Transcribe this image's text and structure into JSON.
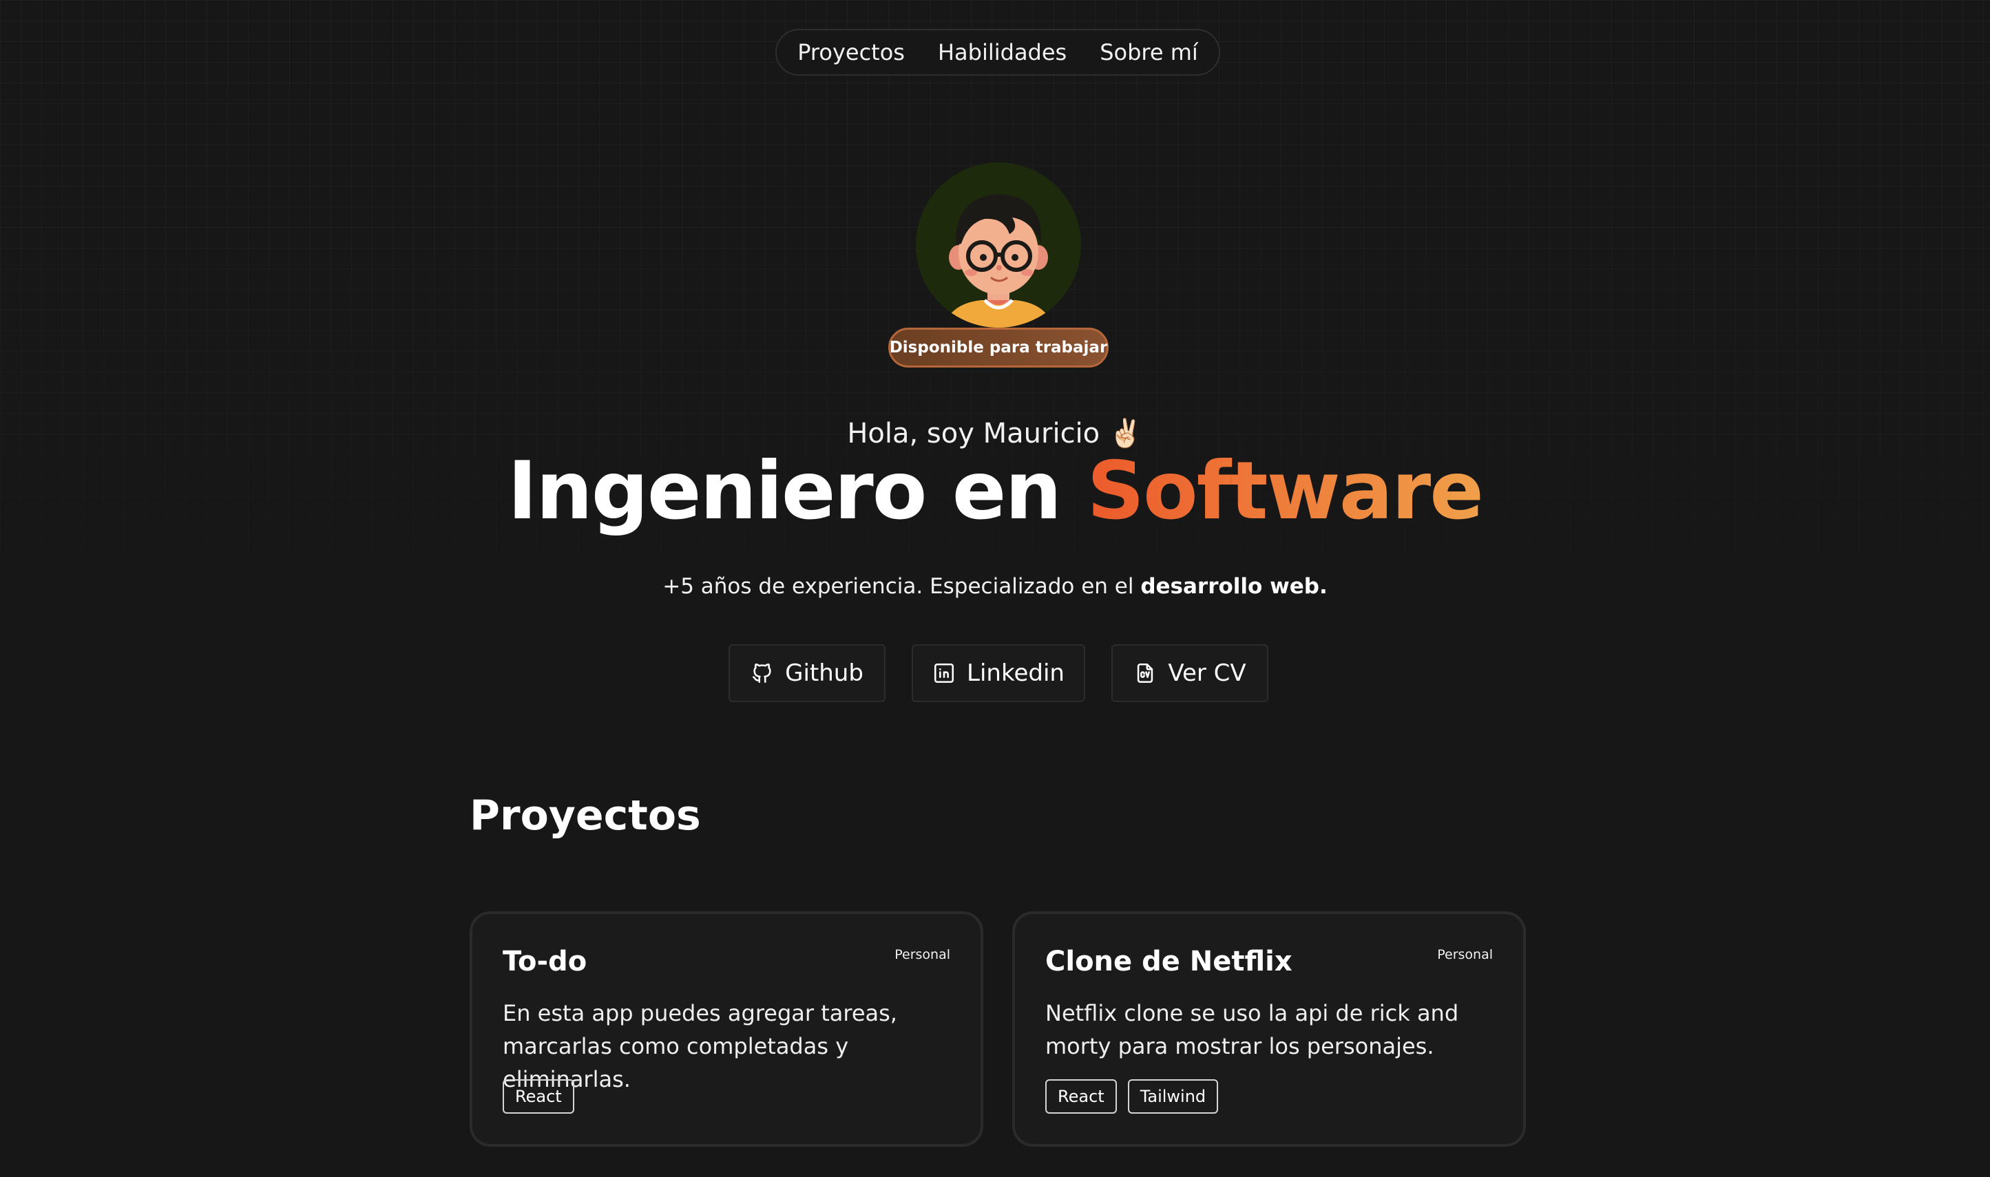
{
  "nav": {
    "items": [
      {
        "label": "Proyectos"
      },
      {
        "label": "Habilidades"
      },
      {
        "label": "Sobre mí"
      }
    ]
  },
  "hero": {
    "badge": "Disponible para trabajar",
    "greeting": "Hola, soy Mauricio ✌🏻",
    "headline_main": "Ingeniero en ",
    "headline_accent": "Software",
    "subtitle_main": "+5 años de experiencia. Especializado en el ",
    "subtitle_bold": "desarrollo web."
  },
  "social": {
    "github_label": "Github",
    "linkedin_label": "Linkedin",
    "cv_label": "Ver CV",
    "github_icon": "github-icon",
    "linkedin_icon": "linkedin-icon",
    "cv_icon": "cv-file-icon"
  },
  "projects": {
    "title": "Proyectos",
    "items": [
      {
        "title": "To-do",
        "type": "Personal",
        "description": "En esta app puedes agregar tareas, marcarlas como completadas y eliminarlas.",
        "tags": [
          "React"
        ]
      },
      {
        "title": "Clone de Netflix",
        "type": "Personal",
        "description": "Netflix clone se uso la api de rick and morty para mostrar los personajes.",
        "tags": [
          "React",
          "Tailwind"
        ]
      }
    ]
  },
  "colors": {
    "background": "#171717",
    "accent_start": "#ec5a2b",
    "accent_end": "#f0a04a",
    "badge_bg": "#7a4a2a"
  }
}
